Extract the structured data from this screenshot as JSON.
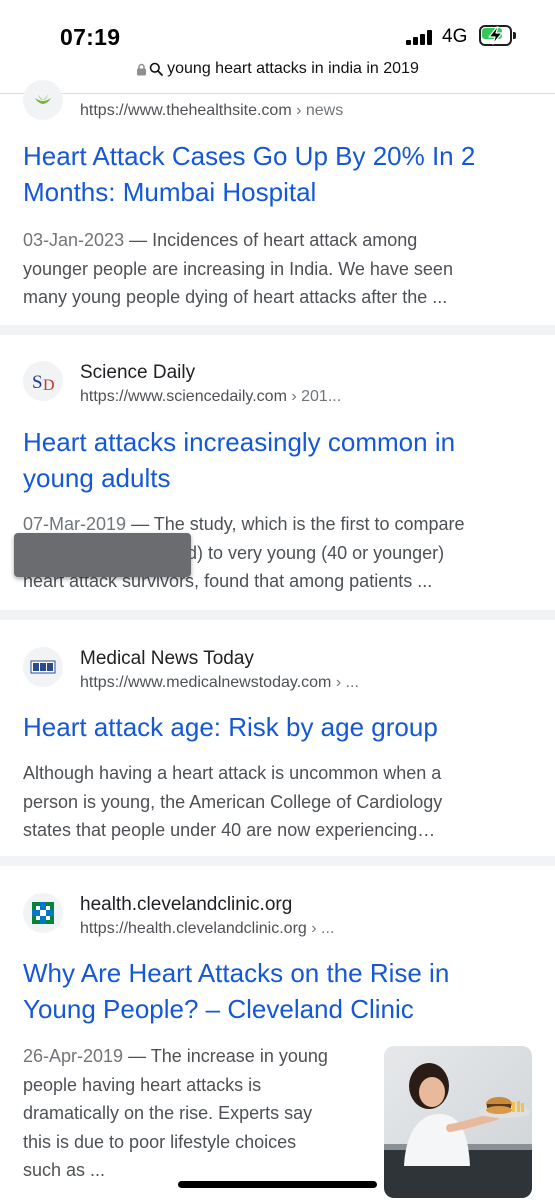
{
  "status_bar": {
    "time": "07:19",
    "network": "4G",
    "battery_fraction": 0.75,
    "battery_color": "#34c759",
    "charging": true
  },
  "url_bar": {
    "query": "young heart attacks in india in 2019",
    "lock_icon": "lock-icon",
    "search_icon": "search-icon"
  },
  "results": [
    {
      "site_url": "https://www.thehealthsite.com",
      "breadcrumb": "› news",
      "title_line1": "Heart Attack Cases Go Up By 20% In 2",
      "title_line2": "Months: Mumbai Hospital",
      "date": "03-Jan-2023",
      "snippet_line1": "Incidences of heart attack among",
      "snippet_line2": "younger people are increasing in India. We have seen",
      "snippet_line3": "many young people dying of heart attacks after the ..."
    },
    {
      "site_name": "Science Daily",
      "site_url": "https://www.sciencedaily.com",
      "breadcrumb": "› 201...",
      "favicon_text": "SD",
      "title_line1": "Heart attacks increasingly common in",
      "title_line2": "young adults",
      "date": "07-Mar-2019",
      "snippet_line1": "The study, which is the first to compare",
      "snippet_line2": "old) to very young (40 or younger)",
      "snippet_line3": "heart attack survivors, found that among patients ..."
    },
    {
      "site_name": "Medical News Today",
      "site_url": "https://www.medicalnewstoday.com",
      "breadcrumb": "› ...",
      "favicon_text": "MNT",
      "title_line1": "Heart attack age: Risk by age group",
      "snippet_line1": "Although having a heart attack is uncommon when a",
      "snippet_line2": "person is young, the American College of Cardiology",
      "snippet_line3": "states that people under 40 are now experiencing…"
    },
    {
      "site_name": "health.clevelandclinic.org",
      "site_url": "https://health.clevelandclinic.org",
      "breadcrumb": "› ...",
      "title_line1": "Why Are Heart Attacks on the Rise in",
      "title_line2": "Young People? – Cleveland Clinic",
      "date": "26-Apr-2019",
      "snippet_line1": "The increase in young",
      "snippet_line2": "people having heart attacks is",
      "snippet_line3": "dramatically on the rise. Experts say",
      "snippet_line4": "this is due to poor lifestyle choices",
      "snippet_line5": "such as ..."
    }
  ],
  "colors": {
    "link": "#1558d6",
    "snippet": "#4d5156",
    "separator": "#f1f3f4",
    "cleveland_green": "#00843d",
    "cleveland_blue": "#0077c8"
  }
}
